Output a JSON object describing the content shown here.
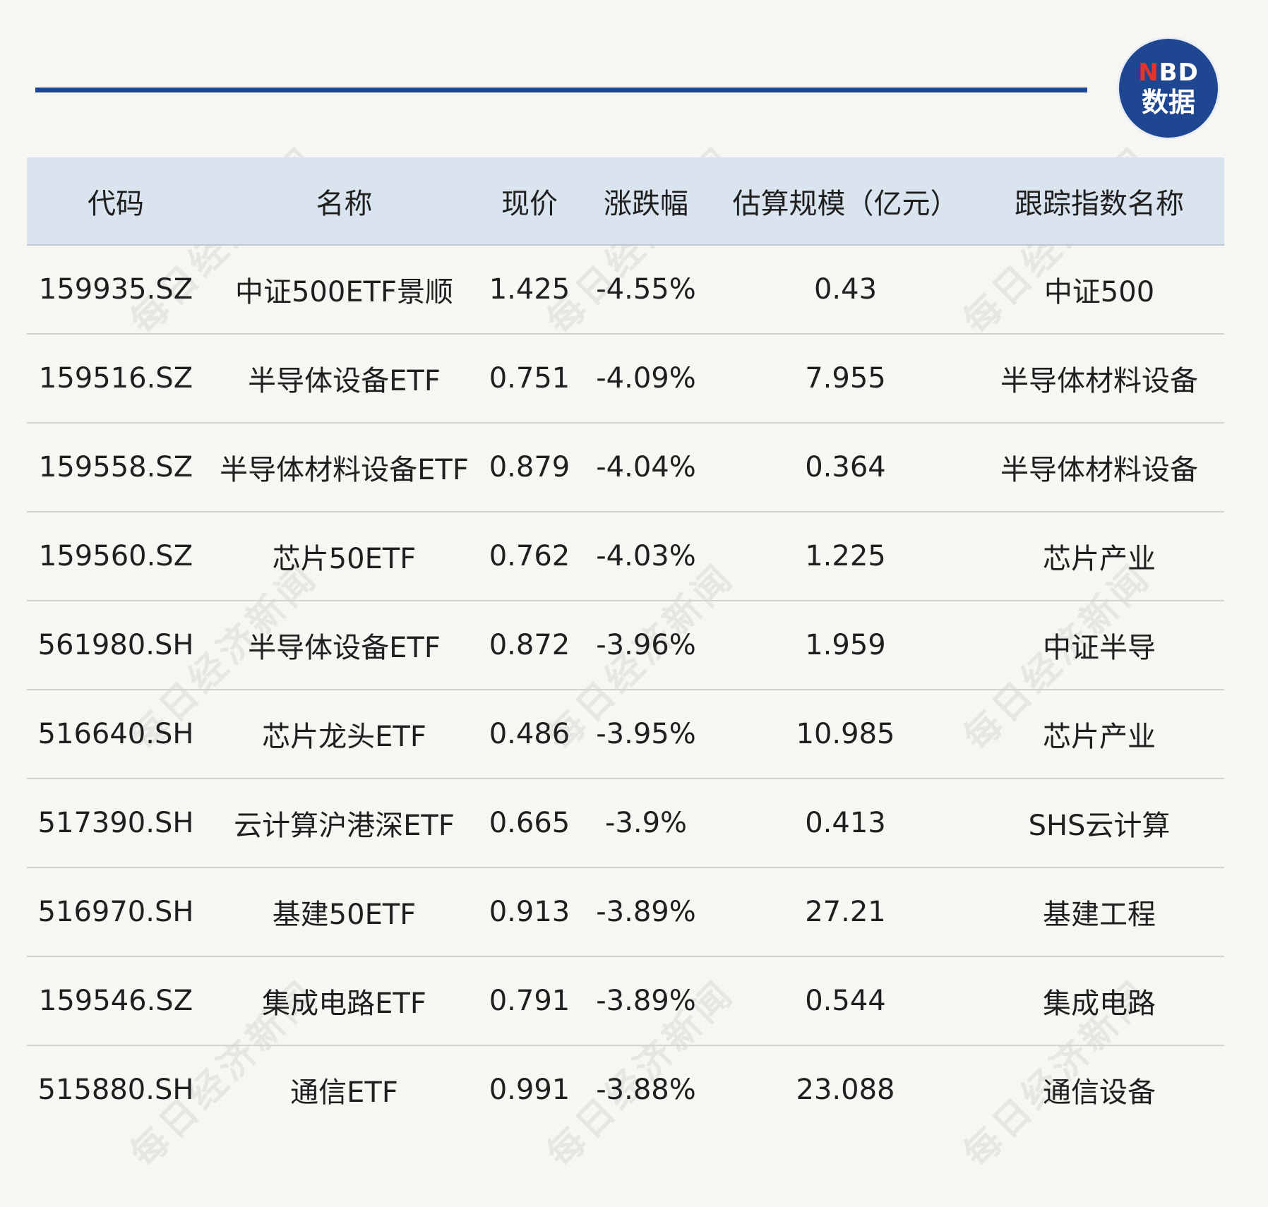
{
  "logo": {
    "brand_n": "N",
    "brand_rest": "BD",
    "sub": "数据"
  },
  "watermark": "每日经济新闻",
  "table": {
    "headers": [
      "代码",
      "名称",
      "现价",
      "涨跌幅",
      "估算规模（亿元）",
      "跟踪指数名称"
    ],
    "rows": [
      [
        "159935.SZ",
        "中证500ETF景顺",
        "1.425",
        "-4.55%",
        "0.43",
        "中证500"
      ],
      [
        "159516.SZ",
        "半导体设备ETF",
        "0.751",
        "-4.09%",
        "7.955",
        "半导体材料设备"
      ],
      [
        "159558.SZ",
        "半导体材料设备ETF",
        "0.879",
        "-4.04%",
        "0.364",
        "半导体材料设备"
      ],
      [
        "159560.SZ",
        "芯片50ETF",
        "0.762",
        "-4.03%",
        "1.225",
        "芯片产业"
      ],
      [
        "561980.SH",
        "半导体设备ETF",
        "0.872",
        "-3.96%",
        "1.959",
        "中证半导"
      ],
      [
        "516640.SH",
        "芯片龙头ETF",
        "0.486",
        "-3.95%",
        "10.985",
        "芯片产业"
      ],
      [
        "517390.SH",
        "云计算沪港深ETF",
        "0.665",
        "-3.9%",
        "0.413",
        "SHS云计算"
      ],
      [
        "516970.SH",
        "基建50ETF",
        "0.913",
        "-3.89%",
        "27.21",
        "基建工程"
      ],
      [
        "159546.SZ",
        "集成电路ETF",
        "0.791",
        "-3.89%",
        "0.544",
        "集成电路"
      ],
      [
        "515880.SH",
        "通信ETF",
        "0.991",
        "-3.88%",
        "23.088",
        "通信设备"
      ]
    ]
  }
}
